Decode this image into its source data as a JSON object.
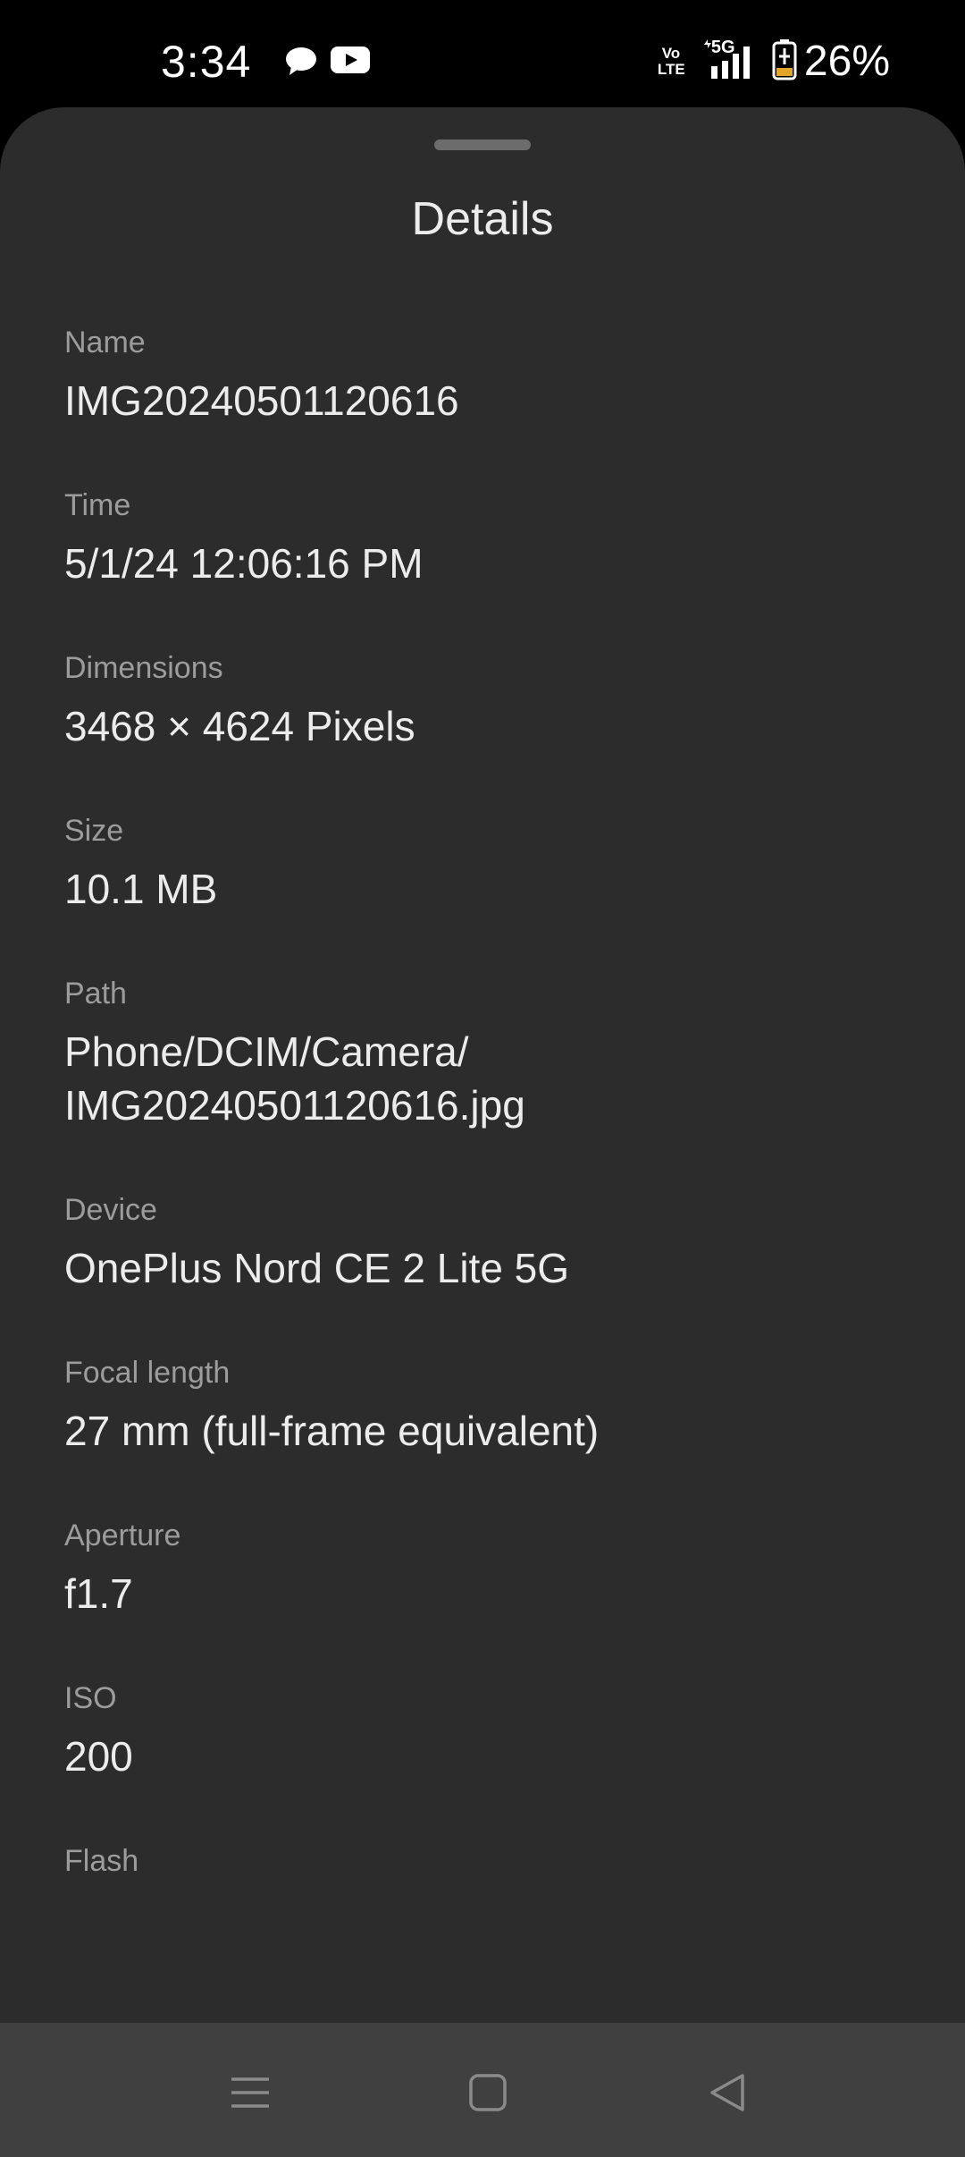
{
  "status_bar": {
    "time": "3:34",
    "notifications": [
      "chat-bubble-icon",
      "youtube-icon"
    ],
    "indicators": [
      "volte-icon",
      "5g-signal-icon",
      "battery-charging-icon"
    ],
    "network_label": "5G",
    "volte_label": "Vo LTE",
    "battery_percent": "26%"
  },
  "sheet": {
    "title": "Details",
    "fields": [
      {
        "label": "Name",
        "value": "IMG20240501120616"
      },
      {
        "label": "Time",
        "value": "5/1/24 12:06:16 PM"
      },
      {
        "label": "Dimensions",
        "value": "3468 × 4624 Pixels"
      },
      {
        "label": "Size",
        "value": "10.1 MB"
      },
      {
        "label": "Path",
        "value": "Phone/DCIM/Camera/\nIMG20240501120616.jpg"
      },
      {
        "label": "Device",
        "value": "OnePlus Nord CE 2 Lite 5G"
      },
      {
        "label": "Focal length",
        "value": "27 mm (full-frame equivalent)"
      },
      {
        "label": "Aperture",
        "value": "f1.7"
      },
      {
        "label": "ISO",
        "value": "200"
      },
      {
        "label": "Flash",
        "value": ""
      }
    ]
  },
  "nav_bar": {
    "buttons": [
      "recents-menu-icon",
      "home-square-icon",
      "back-triangle-icon"
    ]
  },
  "colors": {
    "sheet_background": "#2c2c2c",
    "label_text": "#9c9c9c",
    "value_text": "#ececec",
    "nav_background": "#404040"
  }
}
